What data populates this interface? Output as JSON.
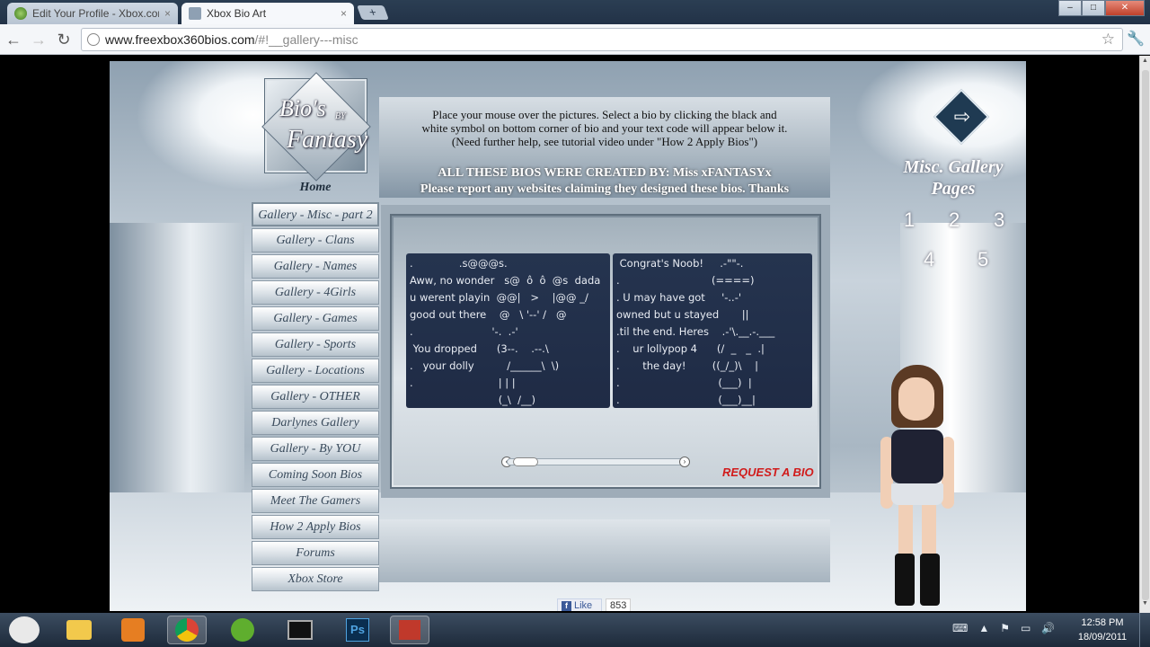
{
  "browser": {
    "tabs": [
      {
        "title": "Edit Your Profile - Xbox.com",
        "active": false,
        "close": "×"
      },
      {
        "title": "Xbox Bio Art",
        "active": true,
        "close": "×"
      }
    ],
    "new_tab_icon": "+",
    "url": {
      "host": "www.freexbox360bios.com",
      "path": "/#!__gallery---misc"
    },
    "window_buttons": {
      "minimize": "–",
      "maximize": "□",
      "close": "✕"
    }
  },
  "site": {
    "logo": {
      "line1": "Bio's",
      "line2": "BY",
      "line3": "Fantasy"
    },
    "menu": [
      {
        "label": "Home",
        "kind": "home"
      },
      {
        "label": "Gallery - Misc - part 2",
        "kind": "current"
      },
      {
        "label": "Gallery - Clans"
      },
      {
        "label": "Gallery - Names"
      },
      {
        "label": "Gallery - 4Girls"
      },
      {
        "label": "Gallery - Games"
      },
      {
        "label": "Gallery - Sports"
      },
      {
        "label": "Gallery - Locations"
      },
      {
        "label": "Gallery - OTHER"
      },
      {
        "label": "Darlynes Gallery"
      },
      {
        "label": "Gallery - By YOU"
      },
      {
        "label": "Coming Soon Bios"
      },
      {
        "label": "Meet The Gamers"
      },
      {
        "label": "How 2 Apply Bios"
      },
      {
        "label": "Forums"
      },
      {
        "label": "Xbox Store"
      }
    ],
    "instructions": {
      "line1": "Place your mouse over the pictures.  Select a bio by clicking the black and",
      "line2": "white symbol on bottom corner of bio and your text code will appear below it.",
      "line3": "(Need further help, see tutorial video under \"How 2 Apply Bios\")",
      "created_by": "ALL THESE BIOS WERE CREATED BY:    Miss xFANTASYx",
      "report": "Please report any websites claiming they designed these bios. Thanks"
    },
    "gallery": {
      "card_a": ".              .s@@@s.\nAww, no wonder   s@  ô  ô  @s  dada\nu werent playin  @@|   >    |@@ _/\ngood out there    @   \\ '--' /   @\n.                        '-.  .-'\n You dropped      (3--.    .--.\\\n.   your dolly          /______\\  \\)\n.                          | | |\n                           (_\\  /__)",
      "card_b": " Congrat's Noob!     .-\"\"-.\n.                            (====)\n. U may have got     '-..-'\nowned but u stayed       ||\n.til the end. Heres    .-'\\.__.-.___\n.    ur lollypop 4      (/  _   _  .|\n.       the day!        ((_/_)\\    |\n.                              (___)  |\n.                              (___)__|",
      "request": "REQUEST A BIO",
      "slider_left": "‹",
      "slider_right": "›"
    },
    "facebook": {
      "like": "Like",
      "count": "853"
    },
    "right": {
      "next_icon": "⇨",
      "title": "Misc. Gallery Pages",
      "pages": [
        "1",
        "2",
        "3",
        "4",
        "5"
      ]
    }
  },
  "taskbar": {
    "time": "12:58 PM",
    "date": "18/09/2011"
  }
}
